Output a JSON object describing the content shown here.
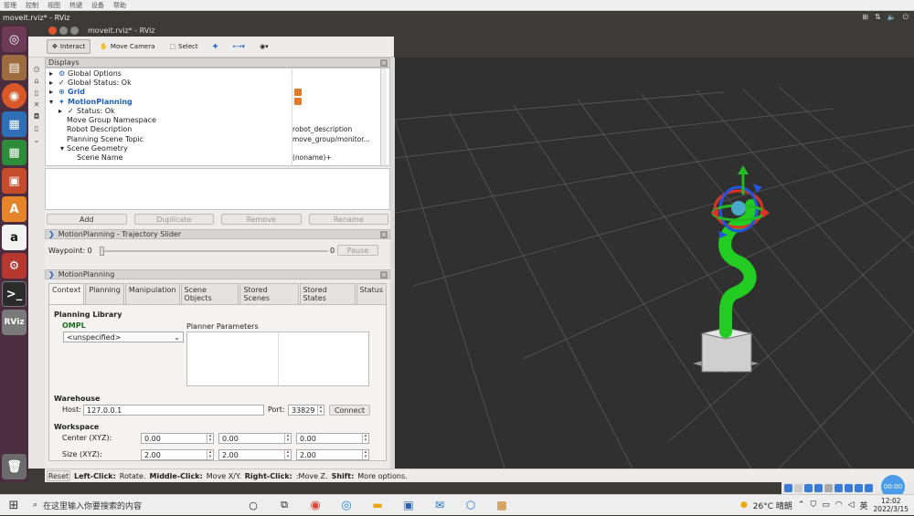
{
  "vm_menu": [
    "管理",
    "控制",
    "视图",
    "热键",
    "设备",
    "帮助"
  ],
  "os": {
    "title": "moveit.rviz* - RViz",
    "indicators": [
      "⊞",
      "⇅",
      "🔈",
      "⏻"
    ]
  },
  "window": {
    "title": "moveit.rviz* - RViz"
  },
  "toolbar": {
    "interact": "Interact",
    "move_camera": "Move Camera",
    "select": "Select"
  },
  "displays": {
    "title": "Displays",
    "rows": [
      {
        "label": "Global Options",
        "value": ""
      },
      {
        "label": "Global Status: Ok",
        "value": ""
      },
      {
        "label": "Grid",
        "value": ""
      },
      {
        "label": "MotionPlanning",
        "value": ""
      },
      {
        "label": "Status: Ok",
        "value": ""
      },
      {
        "label": "Move Group Namespace",
        "value": ""
      },
      {
        "label": "Robot Description",
        "value": "robot_description"
      },
      {
        "label": "Planning Scene Topic",
        "value": "move_group/monitor..."
      },
      {
        "label": "Scene Geometry",
        "value": ""
      },
      {
        "label": "Scene Name",
        "value": "(noname)+"
      }
    ],
    "buttons": {
      "add": "Add",
      "duplicate": "Duplicate",
      "remove": "Remove",
      "rename": "Rename"
    }
  },
  "slider_panel": {
    "title": "MotionPlanning - Trajectory Slider",
    "waypoint_label": "Waypoint: 0",
    "end_value": "0",
    "pause": "Pause"
  },
  "motion_panel": {
    "title": "MotionPlanning",
    "tabs": [
      "Context",
      "Planning",
      "Manipulation",
      "Scene Objects",
      "Stored Scenes",
      "Stored States",
      "Status"
    ],
    "planning_library": "Planning Library",
    "ompl": "OMPL",
    "planner_select": "<unspecified>",
    "planner_parameters": "Planner Parameters",
    "warehouse": "Warehouse",
    "host_label": "Host:",
    "host_value": "127.0.0.1",
    "port_label": "Port:",
    "port_value": "33829",
    "connect": "Connect",
    "workspace": "Workspace",
    "center_label": "Center (XYZ):",
    "center": [
      "0.00",
      "0.00",
      "0.00"
    ],
    "size_label": "Size (XYZ):",
    "size": [
      "2.00",
      "2.00",
      "2.00"
    ]
  },
  "statusbar": {
    "reset": "Reset",
    "left_click": "Left-Click:",
    "left_text": "Rotate.",
    "middle_click": "Middle-Click:",
    "middle_text": "Move X/Y.",
    "right_click": "Right-Click:",
    "right_text": ":Move Z.",
    "shift": "Shift:",
    "shift_text": "More options."
  },
  "taskbar": {
    "search_placeholder": "在这里输入你要搜索的内容",
    "weather": "26°C 晴朗",
    "ime": "英",
    "time": "12:02",
    "date": "2022/3/15",
    "badge": "00:00"
  },
  "colors": {
    "accent": "#e07b29",
    "link_blue": "#1f5fbf",
    "robot_green": "#22cc22",
    "ompl_green": "#1e6e1e"
  }
}
